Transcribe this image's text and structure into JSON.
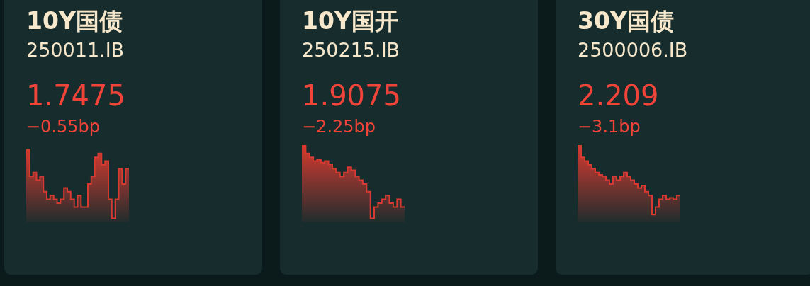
{
  "quotes": [
    {
      "name": "10Y国债",
      "code": "250011.IB",
      "yield": "1.7475",
      "change": "−0.55bp"
    },
    {
      "name": "10Y国开",
      "code": "250215.IB",
      "yield": "1.9075",
      "change": "−2.25bp"
    },
    {
      "name": "30Y国债",
      "code": "2500006.IB",
      "yield": "2.209",
      "change": "−3.1bp"
    }
  ]
}
